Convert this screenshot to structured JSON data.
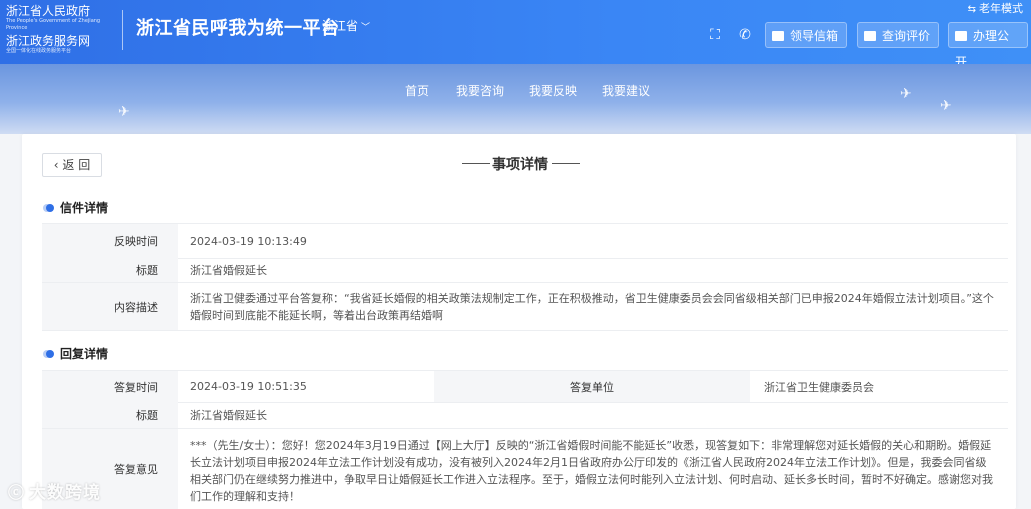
{
  "header": {
    "logo_line1": "浙江省人民政府",
    "logo_line1_sub": "The People's Government of Zhejiang Province",
    "logo_line2": "浙江政务服务网",
    "logo_line2_sub": "全国一体化在线政务服务平台",
    "platform_title": "浙江省民呼我为统一平台",
    "province": "浙江省",
    "elder_mode": "老年模式",
    "btn_leader_mail": "领导信箱",
    "btn_query_eval": "查询评价",
    "btn_publish": "办理公开"
  },
  "nav": {
    "items": [
      "首页",
      "我要咨询",
      "我要反映",
      "我要建议"
    ]
  },
  "page": {
    "back_label": "返 回",
    "title": "事项详情"
  },
  "letter": {
    "section_title": "信件详情",
    "time_label": "反映时间",
    "time_value": "2024-03-19 10:13:49",
    "subject_label": "标题",
    "subject_value": "浙江省婚假延长",
    "content_label": "内容描述",
    "content_value": "浙江省卫健委通过平台答复称：“我省延长婚假的相关政策法规制定工作，正在积极推动，省卫生健康委员会会同省级相关部门已申报2024年婚假立法计划项目。”这个婚假时间到底能不能延长啊，等着出台政策再结婚啊"
  },
  "reply": {
    "section_title": "回复详情",
    "time_label": "答复时间",
    "time_value": "2024-03-19 10:51:35",
    "unit_label": "答复单位",
    "unit_value": "浙江省卫生健康委员会",
    "subject_label": "标题",
    "subject_value": "浙江省婚假延长",
    "opinion_label": "答复意见",
    "opinion_value": "***（先生/女士）：您好！您2024年3月19日通过【网上大厅】反映的“浙江省婚假时间能不能延长”收悉，现答复如下：非常理解您对延长婚假的关心和期盼。婚假延长立法计划项目申报2024年立法工作计划没有成功，没有被列入2024年2月1日省政府办公厅印发的《浙江省人民政府2024年立法工作计划》。但是，我委会同省级相关部门仍在继续努力推进中，争取早日让婚假延长工作进入立法程序。至于，婚假立法何时能列入立法计划、何时启动、延长多长时间，暂时不好确定。感谢您对我们工作的理解和支持！"
  },
  "watermark": "大数跨境",
  "colors": {
    "header_blue": "#3a86f5",
    "accent": "#2f6fe6"
  }
}
